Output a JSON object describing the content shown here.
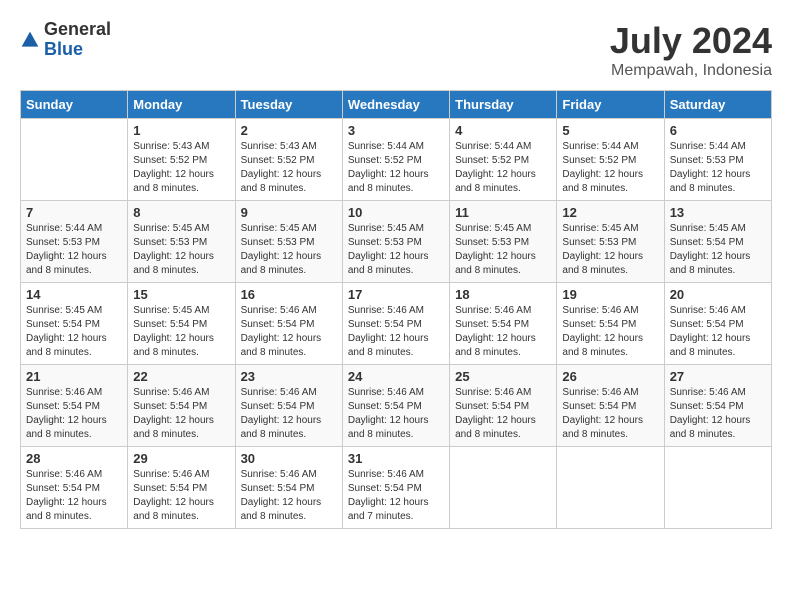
{
  "logo": {
    "general": "General",
    "blue": "Blue"
  },
  "title": {
    "month_year": "July 2024",
    "location": "Mempawah, Indonesia"
  },
  "days_of_week": [
    "Sunday",
    "Monday",
    "Tuesday",
    "Wednesday",
    "Thursday",
    "Friday",
    "Saturday"
  ],
  "weeks": [
    [
      {
        "day": "",
        "sunrise": "",
        "sunset": "",
        "daylight": ""
      },
      {
        "day": "1",
        "sunrise": "Sunrise: 5:43 AM",
        "sunset": "Sunset: 5:52 PM",
        "daylight": "Daylight: 12 hours and 8 minutes."
      },
      {
        "day": "2",
        "sunrise": "Sunrise: 5:43 AM",
        "sunset": "Sunset: 5:52 PM",
        "daylight": "Daylight: 12 hours and 8 minutes."
      },
      {
        "day": "3",
        "sunrise": "Sunrise: 5:44 AM",
        "sunset": "Sunset: 5:52 PM",
        "daylight": "Daylight: 12 hours and 8 minutes."
      },
      {
        "day": "4",
        "sunrise": "Sunrise: 5:44 AM",
        "sunset": "Sunset: 5:52 PM",
        "daylight": "Daylight: 12 hours and 8 minutes."
      },
      {
        "day": "5",
        "sunrise": "Sunrise: 5:44 AM",
        "sunset": "Sunset: 5:52 PM",
        "daylight": "Daylight: 12 hours and 8 minutes."
      },
      {
        "day": "6",
        "sunrise": "Sunrise: 5:44 AM",
        "sunset": "Sunset: 5:53 PM",
        "daylight": "Daylight: 12 hours and 8 minutes."
      }
    ],
    [
      {
        "day": "7",
        "sunrise": "Sunrise: 5:44 AM",
        "sunset": "Sunset: 5:53 PM",
        "daylight": "Daylight: 12 hours and 8 minutes."
      },
      {
        "day": "8",
        "sunrise": "Sunrise: 5:45 AM",
        "sunset": "Sunset: 5:53 PM",
        "daylight": "Daylight: 12 hours and 8 minutes."
      },
      {
        "day": "9",
        "sunrise": "Sunrise: 5:45 AM",
        "sunset": "Sunset: 5:53 PM",
        "daylight": "Daylight: 12 hours and 8 minutes."
      },
      {
        "day": "10",
        "sunrise": "Sunrise: 5:45 AM",
        "sunset": "Sunset: 5:53 PM",
        "daylight": "Daylight: 12 hours and 8 minutes."
      },
      {
        "day": "11",
        "sunrise": "Sunrise: 5:45 AM",
        "sunset": "Sunset: 5:53 PM",
        "daylight": "Daylight: 12 hours and 8 minutes."
      },
      {
        "day": "12",
        "sunrise": "Sunrise: 5:45 AM",
        "sunset": "Sunset: 5:53 PM",
        "daylight": "Daylight: 12 hours and 8 minutes."
      },
      {
        "day": "13",
        "sunrise": "Sunrise: 5:45 AM",
        "sunset": "Sunset: 5:54 PM",
        "daylight": "Daylight: 12 hours and 8 minutes."
      }
    ],
    [
      {
        "day": "14",
        "sunrise": "Sunrise: 5:45 AM",
        "sunset": "Sunset: 5:54 PM",
        "daylight": "Daylight: 12 hours and 8 minutes."
      },
      {
        "day": "15",
        "sunrise": "Sunrise: 5:45 AM",
        "sunset": "Sunset: 5:54 PM",
        "daylight": "Daylight: 12 hours and 8 minutes."
      },
      {
        "day": "16",
        "sunrise": "Sunrise: 5:46 AM",
        "sunset": "Sunset: 5:54 PM",
        "daylight": "Daylight: 12 hours and 8 minutes."
      },
      {
        "day": "17",
        "sunrise": "Sunrise: 5:46 AM",
        "sunset": "Sunset: 5:54 PM",
        "daylight": "Daylight: 12 hours and 8 minutes."
      },
      {
        "day": "18",
        "sunrise": "Sunrise: 5:46 AM",
        "sunset": "Sunset: 5:54 PM",
        "daylight": "Daylight: 12 hours and 8 minutes."
      },
      {
        "day": "19",
        "sunrise": "Sunrise: 5:46 AM",
        "sunset": "Sunset: 5:54 PM",
        "daylight": "Daylight: 12 hours and 8 minutes."
      },
      {
        "day": "20",
        "sunrise": "Sunrise: 5:46 AM",
        "sunset": "Sunset: 5:54 PM",
        "daylight": "Daylight: 12 hours and 8 minutes."
      }
    ],
    [
      {
        "day": "21",
        "sunrise": "Sunrise: 5:46 AM",
        "sunset": "Sunset: 5:54 PM",
        "daylight": "Daylight: 12 hours and 8 minutes."
      },
      {
        "day": "22",
        "sunrise": "Sunrise: 5:46 AM",
        "sunset": "Sunset: 5:54 PM",
        "daylight": "Daylight: 12 hours and 8 minutes."
      },
      {
        "day": "23",
        "sunrise": "Sunrise: 5:46 AM",
        "sunset": "Sunset: 5:54 PM",
        "daylight": "Daylight: 12 hours and 8 minutes."
      },
      {
        "day": "24",
        "sunrise": "Sunrise: 5:46 AM",
        "sunset": "Sunset: 5:54 PM",
        "daylight": "Daylight: 12 hours and 8 minutes."
      },
      {
        "day": "25",
        "sunrise": "Sunrise: 5:46 AM",
        "sunset": "Sunset: 5:54 PM",
        "daylight": "Daylight: 12 hours and 8 minutes."
      },
      {
        "day": "26",
        "sunrise": "Sunrise: 5:46 AM",
        "sunset": "Sunset: 5:54 PM",
        "daylight": "Daylight: 12 hours and 8 minutes."
      },
      {
        "day": "27",
        "sunrise": "Sunrise: 5:46 AM",
        "sunset": "Sunset: 5:54 PM",
        "daylight": "Daylight: 12 hours and 8 minutes."
      }
    ],
    [
      {
        "day": "28",
        "sunrise": "Sunrise: 5:46 AM",
        "sunset": "Sunset: 5:54 PM",
        "daylight": "Daylight: 12 hours and 8 minutes."
      },
      {
        "day": "29",
        "sunrise": "Sunrise: 5:46 AM",
        "sunset": "Sunset: 5:54 PM",
        "daylight": "Daylight: 12 hours and 8 minutes."
      },
      {
        "day": "30",
        "sunrise": "Sunrise: 5:46 AM",
        "sunset": "Sunset: 5:54 PM",
        "daylight": "Daylight: 12 hours and 8 minutes."
      },
      {
        "day": "31",
        "sunrise": "Sunrise: 5:46 AM",
        "sunset": "Sunset: 5:54 PM",
        "daylight": "Daylight: 12 hours and 7 minutes."
      },
      {
        "day": "",
        "sunrise": "",
        "sunset": "",
        "daylight": ""
      },
      {
        "day": "",
        "sunrise": "",
        "sunset": "",
        "daylight": ""
      },
      {
        "day": "",
        "sunrise": "",
        "sunset": "",
        "daylight": ""
      }
    ]
  ]
}
